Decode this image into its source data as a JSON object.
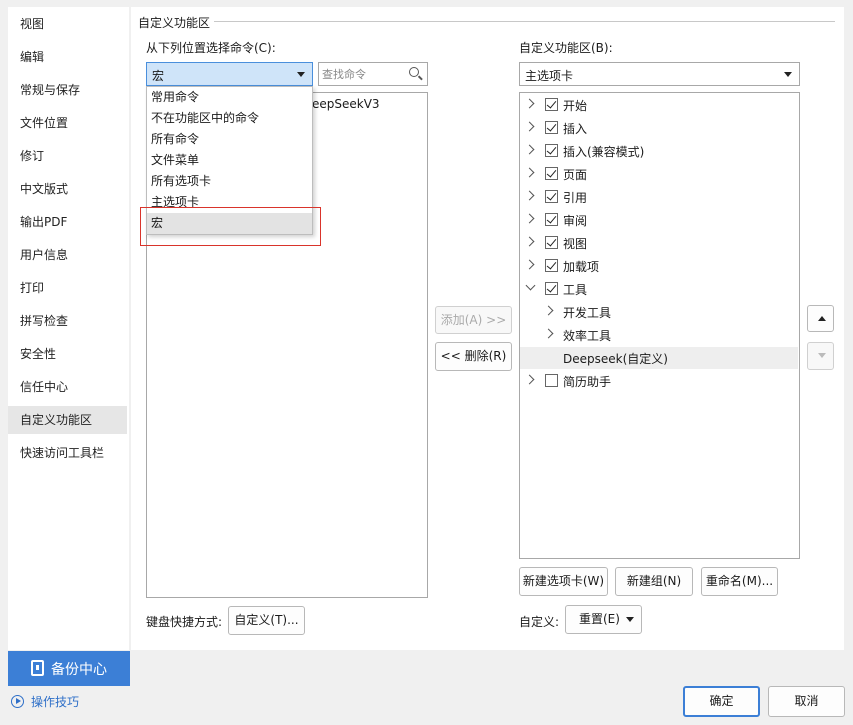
{
  "sidebar": {
    "items": [
      {
        "label": "视图"
      },
      {
        "label": "编辑"
      },
      {
        "label": "常规与保存"
      },
      {
        "label": "文件位置"
      },
      {
        "label": "修订"
      },
      {
        "label": "中文版式"
      },
      {
        "label": "输出PDF"
      },
      {
        "label": "用户信息"
      },
      {
        "label": "打印"
      },
      {
        "label": "拼写检查"
      },
      {
        "label": "安全性"
      },
      {
        "label": "信任中心"
      },
      {
        "label": "自定义功能区"
      },
      {
        "label": "快速访问工具栏"
      }
    ],
    "active": "自定义功能区",
    "backup_label": "备份中心",
    "tips_label": "操作技巧"
  },
  "section_title": "自定义功能区",
  "left": {
    "choose_label": "从下列位置选择命令(C):",
    "combo_value": "宏",
    "search_placeholder": "查找命令",
    "list_partial_text": "eepSeekV3",
    "dropdown_options": [
      "常用命令",
      "不在功能区中的命令",
      "所有命令",
      "文件菜单",
      "所有选项卡",
      "主选项卡",
      "宏"
    ],
    "dropdown_highlighted": "宏",
    "shortcut_label": "键盘快捷方式:",
    "shortcut_button": "自定义(T)..."
  },
  "middle": {
    "add_button": "添加(A) >>",
    "remove_button": "<< 删除(R)"
  },
  "right": {
    "customize_label": "自定义功能区(B):",
    "combo_value": "主选项卡",
    "tree": [
      {
        "label": "开始",
        "checked": true
      },
      {
        "label": "插入",
        "checked": true
      },
      {
        "label": "插入(兼容模式)",
        "checked": true
      },
      {
        "label": "页面",
        "checked": true
      },
      {
        "label": "引用",
        "checked": true
      },
      {
        "label": "审阅",
        "checked": true
      },
      {
        "label": "视图",
        "checked": true
      },
      {
        "label": "加载项",
        "checked": true
      },
      {
        "label": "工具",
        "checked": true,
        "expanded": true
      },
      {
        "label": "开发工具"
      },
      {
        "label": "效率工具"
      },
      {
        "label": "Deepseek(自定义)",
        "selected": true
      },
      {
        "label": "简历助手",
        "checked": false
      }
    ],
    "new_tab_button": "新建选项卡(W)",
    "new_group_button": "新建组(N)",
    "rename_button": "重命名(M)...",
    "custom_label": "自定义:",
    "reset_button": "重置(E)"
  },
  "footer": {
    "ok_button": "确定",
    "cancel_button": "取消"
  },
  "colors": {
    "accent": "#3c7fd6",
    "highlight_box": "#d9342b",
    "combo_focus": "#cfe4f9"
  }
}
